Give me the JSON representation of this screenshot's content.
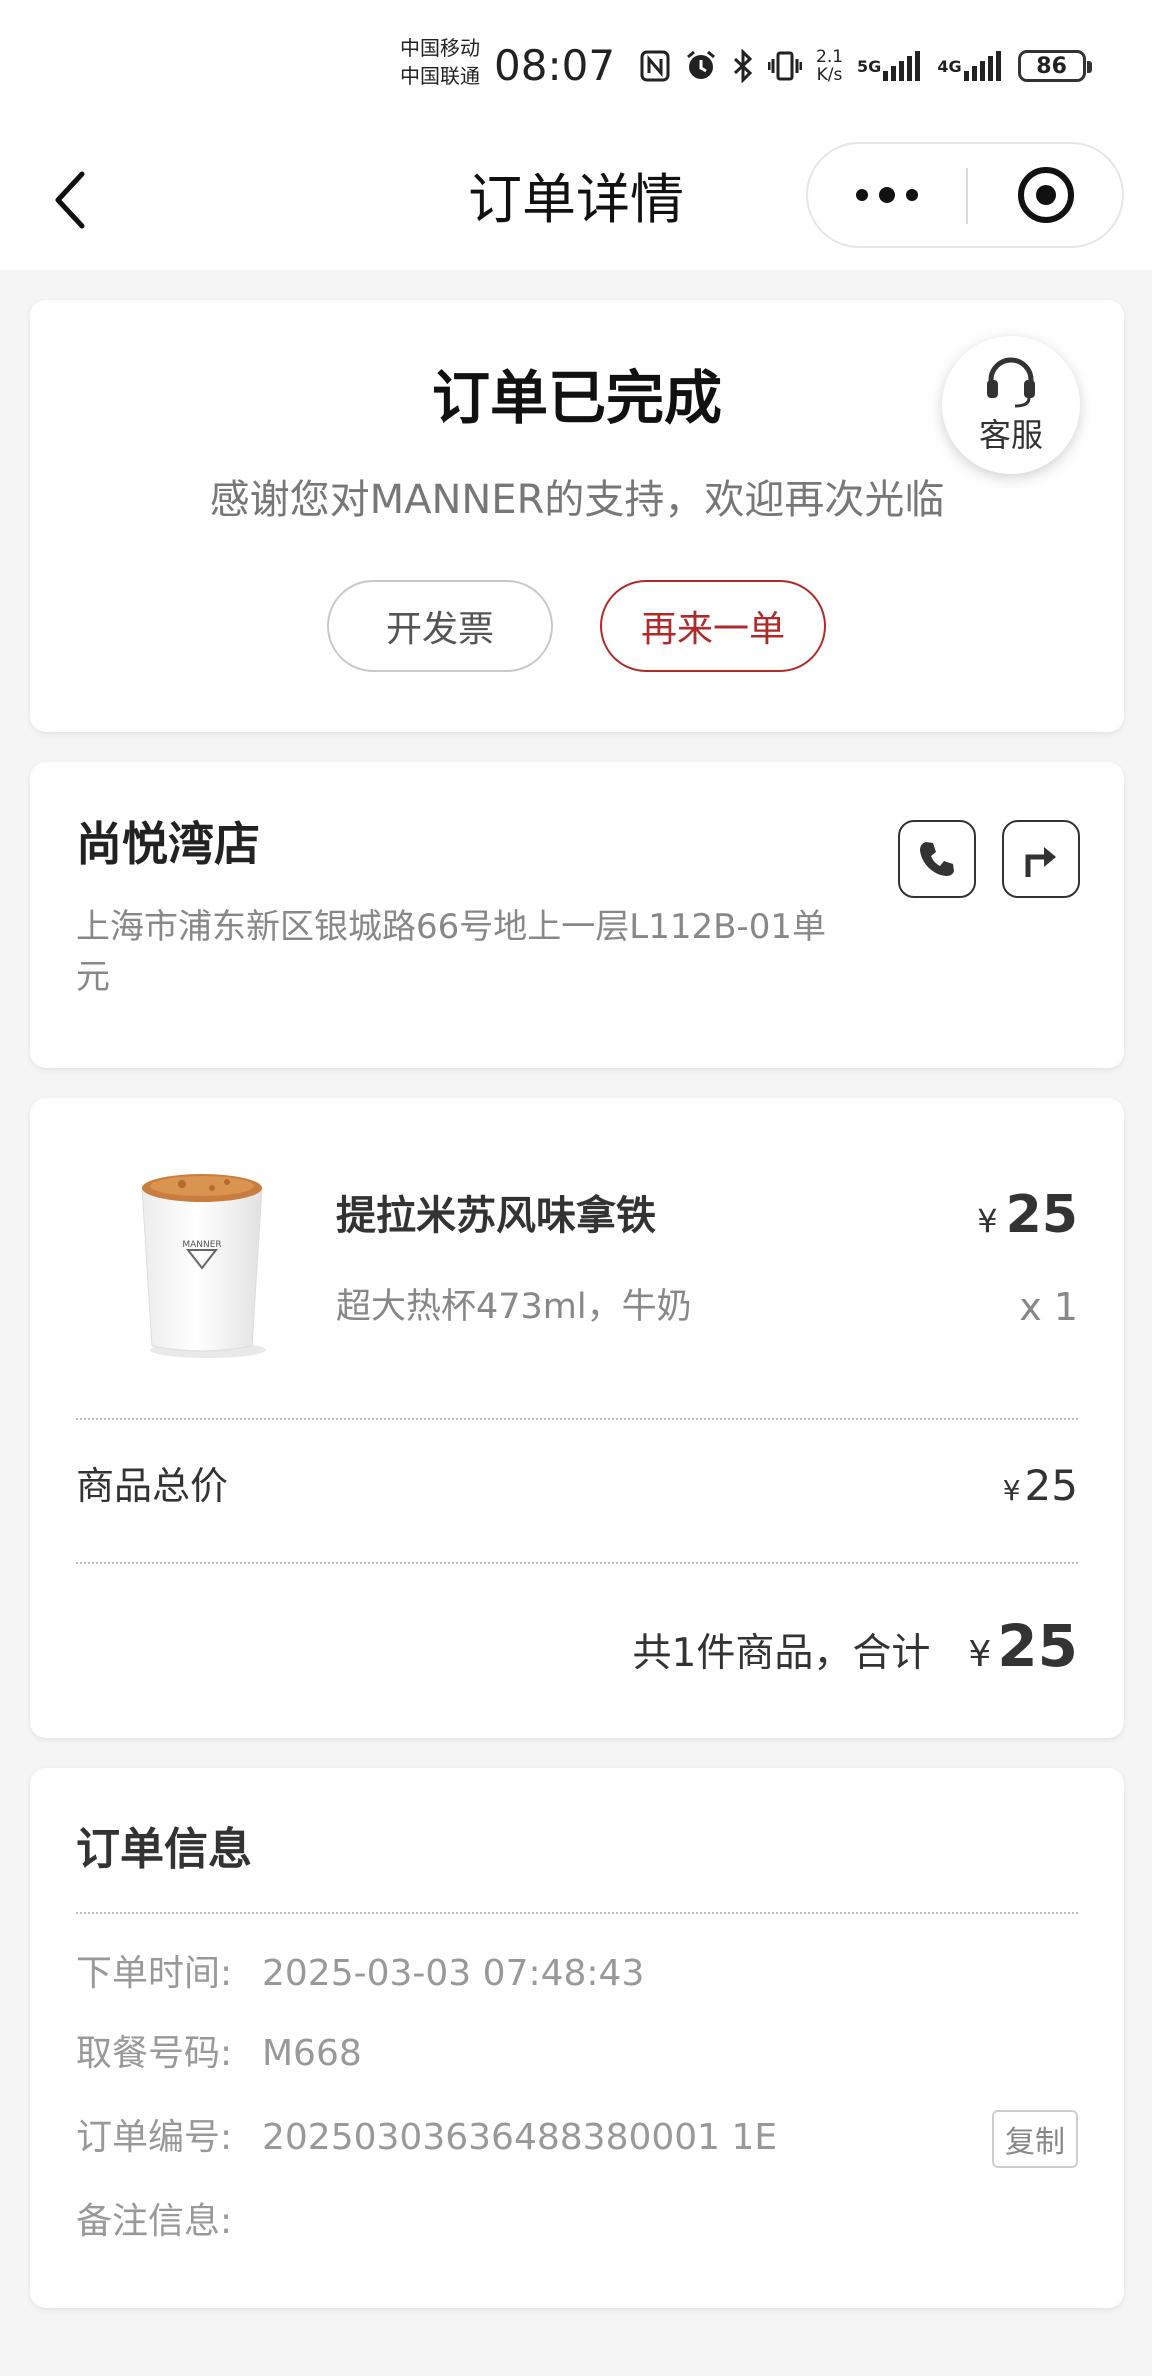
{
  "status_bar": {
    "carrier_1": "中国移动",
    "carrier_2": "中国联通",
    "time": "08:07",
    "net_speed_value": "2.1",
    "net_speed_unit": "K/s",
    "signal_1": "5G",
    "signal_2": "4G",
    "battery": "86"
  },
  "nav": {
    "title": "订单详情"
  },
  "order_status": {
    "title": "订单已完成",
    "subtitle": "感谢您对MANNER的支持，欢迎再次光临",
    "invoice_button": "开发票",
    "reorder_button": "再来一单",
    "customer_service": "客服"
  },
  "store": {
    "name": "尚悦湾店",
    "address": "上海市浦东新区银城路66号地上一层L112B-01单元"
  },
  "product": {
    "name": "提拉米苏风味拿铁",
    "currency": "¥",
    "price": "25",
    "spec": "超大热杯473ml，牛奶",
    "quantity": "x 1",
    "cup_brand": "MANNER"
  },
  "summary": {
    "subtotal_label": "商品总价",
    "subtotal_currency": "¥",
    "subtotal_value": "25",
    "total_label": "共1件商品，合计",
    "total_currency": "¥",
    "total_value": "25"
  },
  "order_info": {
    "title": "订单信息",
    "rows": [
      {
        "label": "下单时间:",
        "value": "2025-03-03 07:48:43"
      },
      {
        "label": "取餐号码:",
        "value": "M668"
      },
      {
        "label": "订单编号:",
        "value": "20250303636488380001 1E"
      },
      {
        "label": "备注信息:",
        "value": ""
      }
    ],
    "copy_button": "复制"
  },
  "colors": {
    "accent_red": "#b02a2a",
    "background": "#f5f5f5",
    "card": "#ffffff",
    "muted_text": "#888888"
  }
}
